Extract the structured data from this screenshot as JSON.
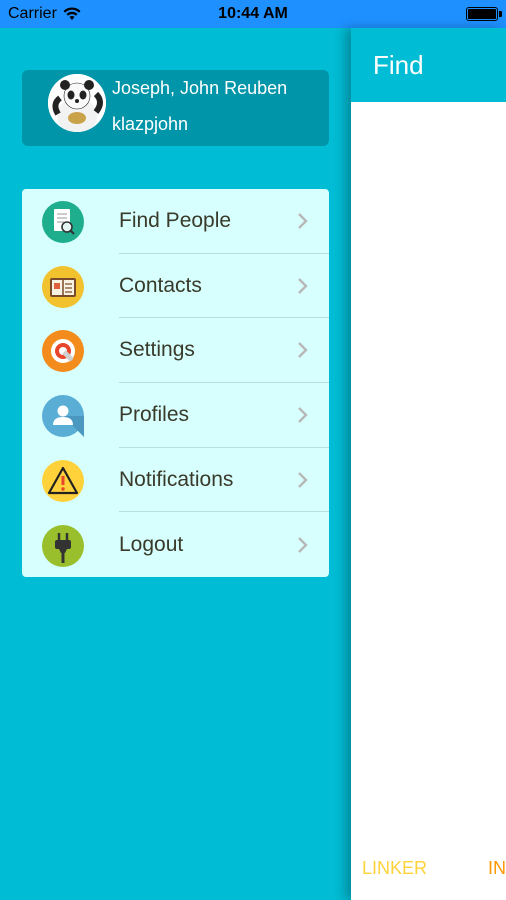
{
  "status_bar": {
    "carrier": "Carrier",
    "time": "10:44 AM",
    "icons": [
      "wifi-icon",
      "battery-icon"
    ]
  },
  "user": {
    "name": "Joseph, John Reuben",
    "username": "klazpjohn",
    "avatar_icon": "panda-avatar-icon"
  },
  "menu": {
    "items": [
      {
        "label": "Find People",
        "icon": "find-people-icon",
        "color": "#1fae8d"
      },
      {
        "label": "Contacts",
        "icon": "contacts-icon",
        "color": "#f2c12e"
      },
      {
        "label": "Settings",
        "icon": "settings-icon",
        "color": "#f38b1d"
      },
      {
        "label": "Profiles",
        "icon": "profile-icon",
        "color": "#5aaed6"
      },
      {
        "label": "Notifications",
        "icon": "warning-icon",
        "color": "#ffd13a"
      },
      {
        "label": "Logout",
        "icon": "plug-icon",
        "color": "#9abf2d"
      }
    ]
  },
  "panel": {
    "title": "Find",
    "tabs": [
      "LINKER",
      "IN"
    ]
  },
  "colors": {
    "drawer_bg": "#00bcd4",
    "user_card_bg": "#0095a8",
    "menu_bg": "#d6fffe",
    "status_bar_bg": "#1e90ff",
    "tab_linker": "#ffd23a",
    "tab_in": "#ff9800"
  }
}
